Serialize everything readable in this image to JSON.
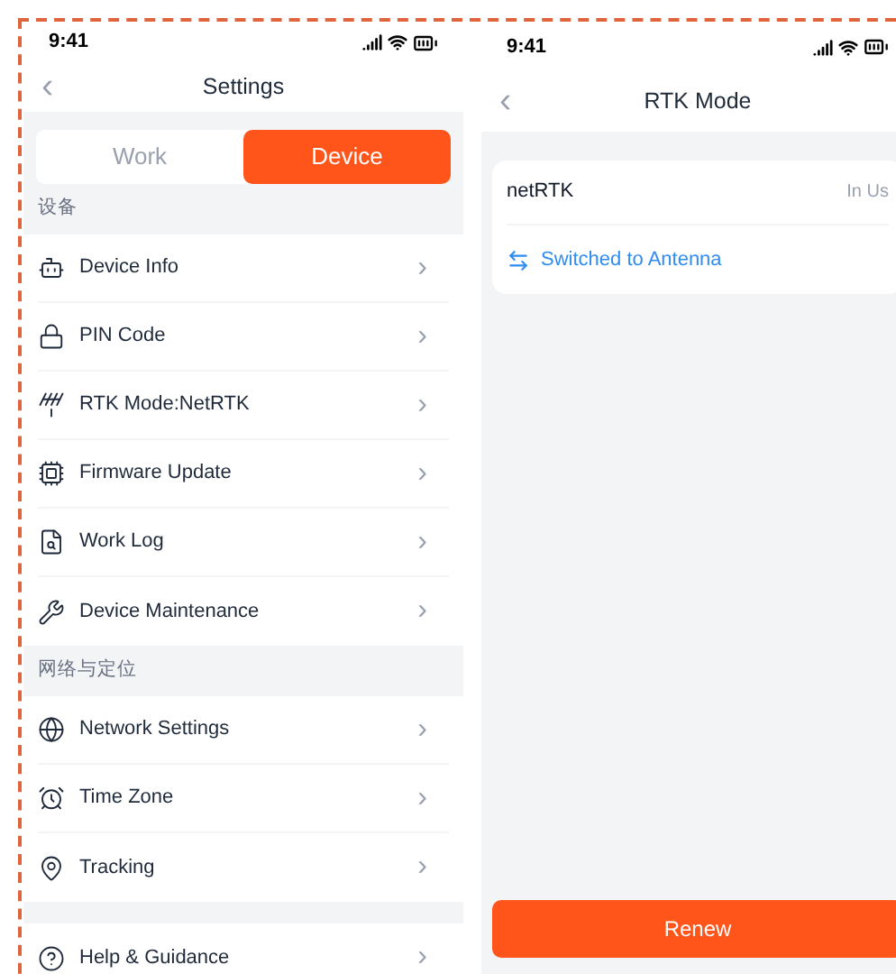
{
  "settings_screen": {
    "status_bar": {
      "time": "9:41"
    },
    "nav": {
      "back": "‹",
      "title": "Settings"
    },
    "tabs": [
      {
        "label": "Work",
        "selected": false
      },
      {
        "label": "Device",
        "selected": true
      }
    ],
    "sections": [
      {
        "title": "设备",
        "items": [
          {
            "label": "Device Info",
            "chevron": "›"
          },
          {
            "label": "PIN Code",
            "chevron": "›"
          },
          {
            "label": "RTK Mode:NetRTK",
            "chevron": "›"
          },
          {
            "label": "Firmware Update",
            "chevron": "›"
          },
          {
            "label": "Work Log",
            "chevron": "›"
          },
          {
            "label": "Device Maintenance",
            "chevron": "›"
          }
        ]
      },
      {
        "title": "网络与定位",
        "items": [
          {
            "label": "Network Settings",
            "chevron": "›"
          },
          {
            "label": "Time Zone",
            "chevron": "›"
          },
          {
            "label": "Tracking",
            "chevron": "›"
          }
        ]
      },
      {
        "items": [
          {
            "label": "Help & Guidance",
            "chevron": "›"
          }
        ]
      }
    ]
  },
  "rtk_screen": {
    "status_bar": {
      "time": "9:41"
    },
    "nav": {
      "back": "‹",
      "title": "RTK Mode"
    },
    "card": {
      "name": "netRTK",
      "status": "In Us",
      "link": "Switched to Antenna"
    },
    "button": "Renew"
  }
}
